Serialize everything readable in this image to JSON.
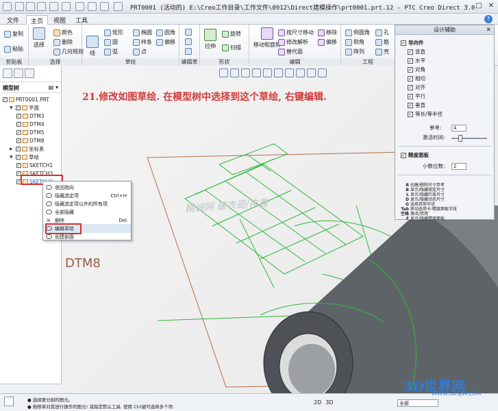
{
  "window": {
    "title": "PRT0001 (活动的) E:\\Creo工作目录\\工作文件\\0912\\Direct建模操作\\prt0001.prt.12 - PTC Creo Direct 3.0"
  },
  "tabs": [
    {
      "label": "文件",
      "active": false
    },
    {
      "label": "主页",
      "active": true
    },
    {
      "label": "视图",
      "active": false
    },
    {
      "label": "工具",
      "active": false
    }
  ],
  "ribbon": {
    "groups": [
      {
        "label": "剪贴板"
      },
      {
        "label": "选择"
      },
      {
        "label": "草绘"
      },
      {
        "label": "编辑草绘"
      },
      {
        "label": "形状"
      },
      {
        "label": "编辑"
      },
      {
        "label": "工程"
      }
    ],
    "clipboard": {
      "copy": "复制",
      "paste": "粘贴"
    },
    "select": {
      "select": "选择",
      "color": "颜色",
      "eraser": "删除",
      "geometry_rule": "几何规则"
    },
    "sketch": {
      "line": "线",
      "rect": "矩形",
      "circle": "圆",
      "arc": "弧",
      "ellipse": "椭圆",
      "offset": "偏移",
      "spline": "样条",
      "point": "点",
      "fillet": "圆角"
    },
    "edit_sketch": {
      "label": ""
    },
    "shape": {
      "extrude": "拉伸",
      "revolve": "旋转",
      "sweep": "扫描"
    },
    "edit": {
      "move_rotate": "移动和旋转",
      "flex_move": "按尺寸移动",
      "modify_analysis": "修改解析",
      "replace": "替代面",
      "shift": "移除",
      "offset": "偏移"
    },
    "engineering": {
      "chamfer_round": "倒圆角",
      "chamfer": "倒角",
      "shell": "抽壳",
      "pattern": "阵列",
      "hole": "孔",
      "rib": "筋",
      "shell2": "壳"
    }
  },
  "model_tree": {
    "header": "模型树",
    "items": [
      {
        "label": "PRT0001.PRT",
        "level": 0,
        "checked": true
      },
      {
        "label": "平面",
        "level": 1,
        "checked": true,
        "expand": "▼"
      },
      {
        "label": "DTM3",
        "level": 2,
        "checked": true
      },
      {
        "label": "DTM4",
        "level": 2,
        "checked": true
      },
      {
        "label": "DTM5",
        "level": 2,
        "checked": true
      },
      {
        "label": "DTM8",
        "level": 2,
        "checked": true
      },
      {
        "label": "坐标系",
        "level": 1,
        "checked": true,
        "expand": "▶"
      },
      {
        "label": "草绘",
        "level": 1,
        "checked": true,
        "expand": "▼"
      },
      {
        "label": "SKETCH1",
        "level": 2,
        "checked": true
      },
      {
        "label": "SKETCH3",
        "level": 2,
        "checked": true
      },
      {
        "label": "SKETCH2",
        "level": 2,
        "checked": true
      }
    ]
  },
  "instruction": "21.修改如图草绘. 在模型树中选择到这个草绘, 右键编辑.",
  "watermark": "精诚网 破衣哥/冉鑫",
  "viewport_label": "DTM8",
  "context_menu": {
    "items": [
      {
        "label": "收回指向",
        "shortcut": ""
      },
      {
        "label": "隐藏选定项",
        "shortcut": "Ctrl+H"
      },
      {
        "label": "隐藏选定项以外的所有项",
        "shortcut": ""
      },
      {
        "label": "全部隐藏",
        "shortcut": ""
      },
      {
        "label": "删除",
        "shortcut": "Del"
      },
      {
        "label": "编辑草绘",
        "shortcut": ""
      },
      {
        "label": "创建剖面",
        "shortcut": ""
      }
    ]
  },
  "design_panel": {
    "title": "设计辅助",
    "guides_label": "导向件",
    "guides": [
      {
        "label": "竖直",
        "checked": true
      },
      {
        "label": "水平",
        "checked": true
      },
      {
        "label": "对角",
        "checked": true
      },
      {
        "label": "相切",
        "checked": true
      },
      {
        "label": "对齐",
        "checked": true
      },
      {
        "label": "平行",
        "checked": true
      },
      {
        "label": "垂直",
        "checked": true
      },
      {
        "label": "等长/等半径",
        "checked": true
      }
    ],
    "reference_label": "参考:",
    "reference_value": "4",
    "snap_label": "激活时间:",
    "precision_label": "精度面板",
    "decimal_label": "小数位数:",
    "decimal_value": "2",
    "shortcuts": [
      {
        "key": "R",
        "text": "创建/删除尺寸参考"
      },
      {
        "key": "B",
        "text": "显示/隐藏锁定尺寸"
      },
      {
        "key": "L",
        "text": "显示/隐藏约束尺寸"
      },
      {
        "key": "D",
        "text": "显示/隐藏动态尺寸"
      },
      {
        "key": "G",
        "text": "选择其他半径"
      },
      {
        "key": "Tab",
        "text": "移动选项卡:精度面板字段"
      },
      {
        "key": "空格",
        "text": "激活/禁用"
      },
      {
        "key": "F",
        "text": "显示/隐藏精度面板"
      }
    ]
  },
  "status": {
    "line1": "● 选择要分割的图元。",
    "line2": "● 拖移草对其进行操作的图元! 或指定默认工具. 使用 Ctrl键可选择多个项.",
    "view_2d": "2D",
    "view_3d": "3D",
    "filter_value": "全部"
  },
  "logo": {
    "name": "3D世界网",
    "url": "WWW.3DSJW.COM"
  }
}
